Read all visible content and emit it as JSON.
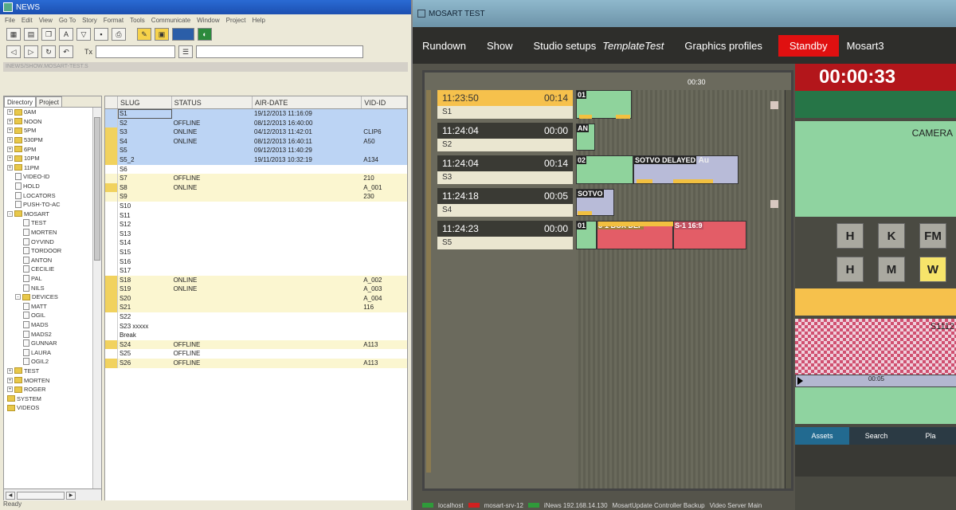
{
  "news": {
    "title": "NEWS",
    "menu": [
      "File",
      "Edit",
      "View",
      "Go To",
      "Story",
      "Format",
      "Tools",
      "Communicate",
      "Window",
      "Project",
      "Help"
    ],
    "tx_label": "Tx",
    "path": "INEWS/SHOW.MOSART-TEST.S",
    "tabs": [
      "Directory",
      "Project"
    ],
    "tree": [
      {
        "label": "0AM",
        "type": "folder",
        "level": 0,
        "exp": "+"
      },
      {
        "label": "NOON",
        "type": "folder",
        "level": 0,
        "exp": "+"
      },
      {
        "label": "5PM",
        "type": "folder",
        "level": 0,
        "exp": "+"
      },
      {
        "label": "530PM",
        "type": "folder",
        "level": 0,
        "exp": "+"
      },
      {
        "label": "6PM",
        "type": "folder",
        "level": 0,
        "exp": "+"
      },
      {
        "label": "10PM",
        "type": "folder",
        "level": 0,
        "exp": "+"
      },
      {
        "label": "11PM",
        "type": "folder",
        "level": 0,
        "exp": "+"
      },
      {
        "label": "VIDEO-ID",
        "type": "doc",
        "level": 1
      },
      {
        "label": "HOLD",
        "type": "doc",
        "level": 1
      },
      {
        "label": "LOCATORS",
        "type": "doc",
        "level": 1
      },
      {
        "label": "PUSH-TO-AC",
        "type": "doc",
        "level": 1
      },
      {
        "label": "MOSART",
        "type": "folder",
        "level": 0,
        "exp": "-"
      },
      {
        "label": "TEST",
        "type": "doc",
        "level": 2
      },
      {
        "label": "MORTEN",
        "type": "doc",
        "level": 2
      },
      {
        "label": "OYVIND",
        "type": "doc",
        "level": 2
      },
      {
        "label": "TORDOOR",
        "type": "doc",
        "level": 2
      },
      {
        "label": "ANTON",
        "type": "doc",
        "level": 2
      },
      {
        "label": "CECILIE",
        "type": "doc",
        "level": 2
      },
      {
        "label": "PAL",
        "type": "doc",
        "level": 2
      },
      {
        "label": "NILS",
        "type": "doc",
        "level": 2
      },
      {
        "label": "DEVICES",
        "type": "folder",
        "level": 1,
        "exp": "-"
      },
      {
        "label": "MATT",
        "type": "doc",
        "level": 2
      },
      {
        "label": "OGIL",
        "type": "doc",
        "level": 2
      },
      {
        "label": "MADS",
        "type": "doc",
        "level": 2
      },
      {
        "label": "MADS2",
        "type": "doc",
        "level": 2
      },
      {
        "label": "GUNNAR",
        "type": "doc",
        "level": 2
      },
      {
        "label": "LAURA",
        "type": "doc",
        "level": 2
      },
      {
        "label": "OGIL2",
        "type": "doc",
        "level": 2
      },
      {
        "label": "TEST",
        "type": "folder",
        "level": 0,
        "exp": "+"
      },
      {
        "label": "MORTEN",
        "type": "folder",
        "level": 0,
        "exp": "+"
      },
      {
        "label": "ROGER",
        "type": "folder",
        "level": 0,
        "exp": "+"
      },
      {
        "label": "SYSTEM",
        "type": "folder",
        "level": 0,
        "exp": ""
      },
      {
        "label": "VIDEOS",
        "type": "folder",
        "level": 0,
        "exp": ""
      }
    ],
    "columns": [
      "SLUG",
      "STATUS",
      "AIR-DATE",
      "VID-ID"
    ],
    "rows": [
      {
        "slug": "S1",
        "status": "",
        "airdate": "19/12/2013 11:16:09",
        "vid": "",
        "bg": "blue",
        "mark": false
      },
      {
        "slug": "S2",
        "status": "OFFLINE",
        "airdate": "08/12/2013 16:40:00",
        "vid": "",
        "bg": "blue",
        "mark": false
      },
      {
        "slug": "S3",
        "status": "ONLINE",
        "airdate": "04/12/2013 11:42:01",
        "vid": "CLIP6",
        "bg": "blue",
        "mark": true
      },
      {
        "slug": "S4",
        "status": "ONLINE",
        "airdate": "08/12/2013 16:40:11",
        "vid": "A50",
        "bg": "blue",
        "mark": true
      },
      {
        "slug": "S5",
        "status": "",
        "airdate": "09/12/2013 11:40:29",
        "vid": "",
        "bg": "blue",
        "mark": true
      },
      {
        "slug": "S5_2",
        "status": "",
        "airdate": "19/11/2013 10:32:19",
        "vid": "A134",
        "bg": "blue",
        "mark": true
      },
      {
        "slug": "S6",
        "status": "",
        "airdate": "",
        "vid": "",
        "bg": "white",
        "mark": false
      },
      {
        "slug": "S7",
        "status": "OFFLINE",
        "airdate": "",
        "vid": "210",
        "bg": "yellow",
        "mark": false
      },
      {
        "slug": "S8",
        "status": "ONLINE",
        "airdate": "",
        "vid": "A_001",
        "bg": "yellow",
        "mark": true
      },
      {
        "slug": "S9",
        "status": "",
        "airdate": "",
        "vid": "230",
        "bg": "yellow",
        "mark": false
      },
      {
        "slug": "S10",
        "status": "",
        "airdate": "",
        "vid": "",
        "bg": "white",
        "mark": false
      },
      {
        "slug": "S11",
        "status": "",
        "airdate": "",
        "vid": "",
        "bg": "white",
        "mark": false
      },
      {
        "slug": "S12",
        "status": "",
        "airdate": "",
        "vid": "",
        "bg": "white",
        "mark": false
      },
      {
        "slug": "S13",
        "status": "",
        "airdate": "",
        "vid": "",
        "bg": "white",
        "mark": false
      },
      {
        "slug": "S14",
        "status": "",
        "airdate": "",
        "vid": "",
        "bg": "white",
        "mark": false
      },
      {
        "slug": "S15",
        "status": "",
        "airdate": "",
        "vid": "",
        "bg": "white",
        "mark": false
      },
      {
        "slug": "S16",
        "status": "",
        "airdate": "",
        "vid": "",
        "bg": "white",
        "mark": false
      },
      {
        "slug": "S17",
        "status": "",
        "airdate": "",
        "vid": "",
        "bg": "white",
        "mark": false
      },
      {
        "slug": "S18",
        "status": "ONLINE",
        "airdate": "",
        "vid": "A_002",
        "bg": "yellow",
        "mark": true
      },
      {
        "slug": "S19",
        "status": "ONLINE",
        "airdate": "",
        "vid": "A_003",
        "bg": "yellow",
        "mark": true
      },
      {
        "slug": "S20",
        "status": "",
        "airdate": "",
        "vid": "A_004",
        "bg": "yellow",
        "mark": true
      },
      {
        "slug": "S21",
        "status": "",
        "airdate": "",
        "vid": "116",
        "bg": "yellow",
        "mark": true
      },
      {
        "slug": "S22",
        "status": "",
        "airdate": "",
        "vid": "",
        "bg": "white",
        "mark": false
      },
      {
        "slug": "S23 xxxxx",
        "status": "",
        "airdate": "",
        "vid": "",
        "bg": "white",
        "mark": false
      },
      {
        "slug": "Break",
        "status": "",
        "airdate": "",
        "vid": "",
        "bg": "white",
        "mark": false
      },
      {
        "slug": "S24",
        "status": "OFFLINE",
        "airdate": "",
        "vid": "A113",
        "bg": "yellow",
        "mark": true
      },
      {
        "slug": "S25",
        "status": "OFFLINE",
        "airdate": "",
        "vid": "",
        "bg": "white",
        "mark": false
      },
      {
        "slug": "S26",
        "status": "OFFLINE",
        "airdate": "",
        "vid": "A113",
        "bg": "yellow",
        "mark": true
      }
    ],
    "status_text": "Ready"
  },
  "mosart": {
    "title": "MOSART TEST",
    "menu": {
      "rundown": "Rundown",
      "show": "Show",
      "studio": "Studio setups",
      "template": "TemplateTest",
      "graphics": "Graphics profiles",
      "standby": "Standby",
      "server": "Mosart3"
    },
    "timeline_marker": "00:30",
    "stories": [
      {
        "time": "11:23:50",
        "dur": "00:14",
        "name": "S1",
        "active": true
      },
      {
        "time": "11:24:04",
        "dur": "00:00",
        "name": "S2",
        "active": false
      },
      {
        "time": "11:24:04",
        "dur": "00:14",
        "name": "S3",
        "active": false
      },
      {
        "time": "11:24:18",
        "dur": "00:05",
        "name": "S4",
        "active": false
      },
      {
        "time": "11:24:23",
        "dur": "00:00",
        "name": "S5",
        "active": false
      }
    ],
    "blocks": {
      "s1": "01",
      "s2": "AN",
      "s3a": "02",
      "s3b": "SOTVO DELAYED",
      "s3c": "Au",
      "s4": "SOTVO",
      "s5a": "01",
      "s5b": "3-1 BOX DEF",
      "s5c": "S-1 16:9"
    },
    "clock": "00:00:33",
    "camera_label": "CAMERA",
    "buttons_row1": [
      "H",
      "K",
      "FM"
    ],
    "buttons_row2": [
      "H",
      "M",
      "W"
    ],
    "checker_label": "S1112",
    "tbar_value": "00:05",
    "tabs": [
      "Assets",
      "Search",
      "Pla"
    ],
    "status": [
      "localhost",
      "mosart-srv-12",
      "iNews 192.168.14.130",
      "MosartUpdate Controller Backup",
      "Video Server Main"
    ]
  },
  "colors": {
    "standby": "#e01010",
    "clock": "#b3161b",
    "story_active": "#f6c14c",
    "green_block": "#8fd39c",
    "red_block": "#e35d67"
  }
}
